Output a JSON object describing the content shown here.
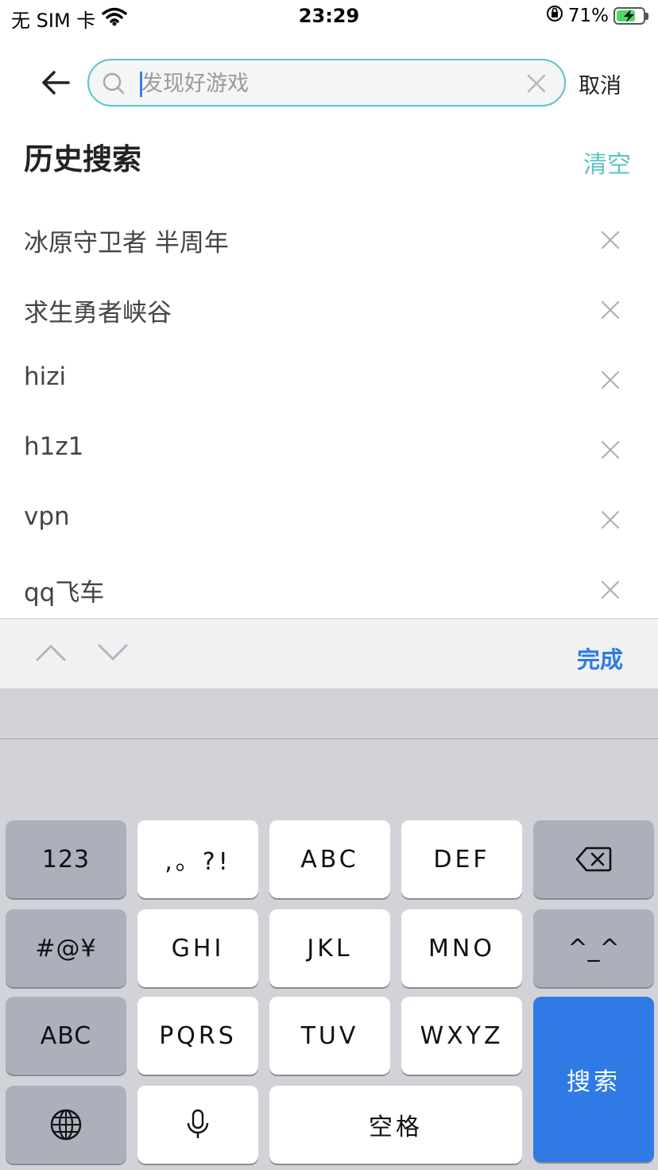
{
  "status_bar": {
    "carrier": "无 SIM 卡",
    "time": "23:29",
    "battery_percent": "71%",
    "battery_level": 0.71,
    "icons": [
      "wifi-icon",
      "orientation-lock-icon",
      "battery-charging-icon"
    ]
  },
  "search": {
    "placeholder": "发现好游戏",
    "value": "",
    "cancel_label": "取消",
    "border_color": "#5bc3c7"
  },
  "history": {
    "title": "历史搜索",
    "clear_label": "清空",
    "items": [
      {
        "text": "冰原守卫者 半周年"
      },
      {
        "text": "求生勇者峡谷"
      },
      {
        "text": "hizi"
      },
      {
        "text": "h1z1"
      },
      {
        "text": "vpn"
      },
      {
        "text": "qq飞车"
      }
    ]
  },
  "accessory_bar": {
    "done_label": "完成"
  },
  "keyboard": {
    "keys": {
      "num": "123",
      "punct": ",。?!",
      "abc1": "ABC",
      "def": "DEF",
      "symbols": "#@¥",
      "ghi": "GHI",
      "jkl": "JKL",
      "mno": "MNO",
      "emoticon": "^_^",
      "abc_switch": "ABC",
      "pqrs": "PQRS",
      "tuv": "TUV",
      "wxyz": "WXYZ",
      "space": "空格",
      "search": "搜索"
    },
    "accent_color": "#2f7ae5"
  }
}
